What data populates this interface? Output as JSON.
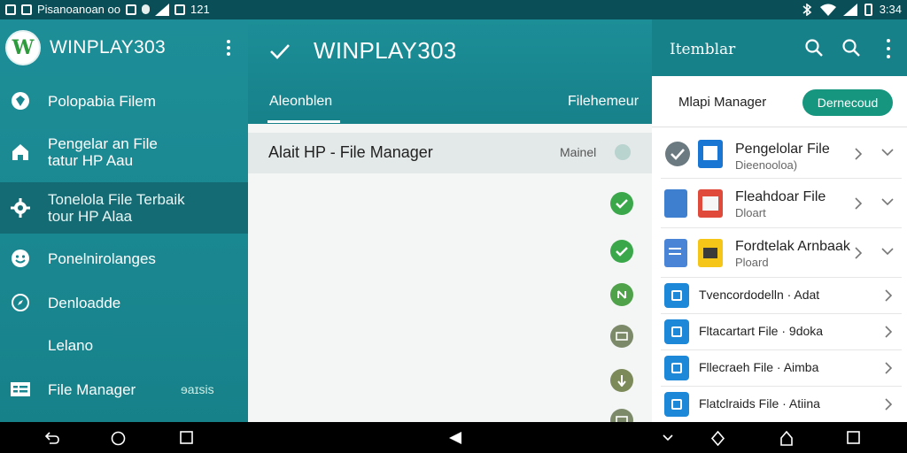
{
  "status_bar": {
    "left_text": "Pisanoanoan oo",
    "sim_text": "121",
    "time": "3:34"
  },
  "drawer": {
    "app_title": "WINPLAY303",
    "logo_letter": "W",
    "items": [
      {
        "label": "Polopabia Filem",
        "icon": "shield-icon"
      },
      {
        "label": "Pengelar an File\ntatur HP Aau",
        "icon": "home-icon"
      },
      {
        "label": "Tonelola File Terbaik\ntour HP Alaa",
        "icon": "gear-icon"
      },
      {
        "label": "Ponelnirolanges",
        "icon": "smiley-icon"
      },
      {
        "label": "Denloadde",
        "icon": "compass-icon"
      },
      {
        "label": "Lelano",
        "icon": ""
      },
      {
        "label": "File Manager",
        "icon": "file-manager-icon"
      }
    ],
    "badge": "ɘaɪsis"
  },
  "main": {
    "title": "WINPLAY303",
    "tabs": [
      {
        "label": "Aleonblen"
      },
      {
        "label": "Filehemeur"
      }
    ],
    "list_header": {
      "title": "Alait HP - File Manager",
      "meta": "Mainel"
    },
    "status_icons": [
      {
        "type": "check",
        "color": "#3aa84a"
      },
      {
        "type": "check",
        "color": "#3aa84a"
      },
      {
        "type": "n",
        "color": "#4fa14a"
      },
      {
        "type": "box",
        "color": "#7c8a6a"
      },
      {
        "type": "d",
        "color": "#7c8a5a"
      },
      {
        "type": "box",
        "color": "#7c8a6a"
      }
    ]
  },
  "right": {
    "toolbar_title": "Itemblar",
    "header_label": "Mlapi Manager",
    "header_button": "Dernecoud",
    "rows": [
      {
        "title": "Pengelolar File",
        "sub": "Dieenooloa)",
        "icon": "doc-blue-icon"
      },
      {
        "title": "Fleahdoar File",
        "sub": "Dloart",
        "icon": "doc-red-icon"
      },
      {
        "title": "Fordtelak Arnbaak",
        "sub": "Ploard",
        "icon": "doc-yellow-icon"
      },
      {
        "title": "Tvencordodelln · Adat",
        "sub": "",
        "icon": "folder-icon"
      },
      {
        "title": "Fltacartart File · 9doka",
        "sub": "",
        "icon": "folder-icon"
      },
      {
        "title": "Fllecraeh File · Aimba",
        "sub": "",
        "icon": "folder-icon"
      },
      {
        "title": "Flatclraids File · Atiina",
        "sub": "",
        "icon": "folder-icon"
      }
    ]
  },
  "colors": {
    "teal": "#17818a",
    "accent_green": "#17967f",
    "check_green": "#3aa84a"
  }
}
